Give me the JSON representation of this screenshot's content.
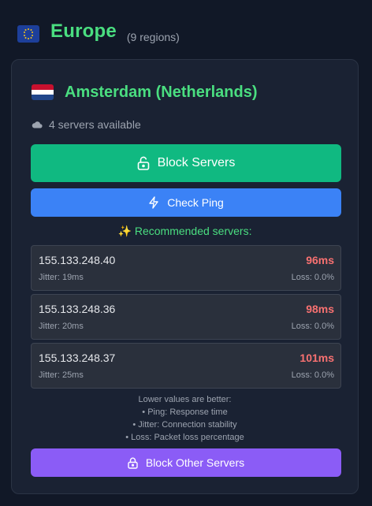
{
  "region": {
    "flag_icon": "eu-flag-icon",
    "title": "Europe",
    "count": "(9 regions)"
  },
  "city": {
    "flag_icon": "netherlands-flag-icon",
    "name": "Amsterdam (Netherlands)",
    "servers_available": "4 servers available"
  },
  "buttons": {
    "block_servers": "Block Servers",
    "check_ping": "Check Ping",
    "block_other": "Block Other Servers"
  },
  "recommended_label": "✨ Recommended servers:",
  "servers": [
    {
      "ip": "155.133.248.40",
      "ping": "96ms",
      "jitter": "Jitter: 19ms",
      "loss": "Loss: 0.0%"
    },
    {
      "ip": "155.133.248.36",
      "ping": "98ms",
      "jitter": "Jitter: 20ms",
      "loss": "Loss: 0.0%"
    },
    {
      "ip": "155.133.248.37",
      "ping": "101ms",
      "jitter": "Jitter: 25ms",
      "loss": "Loss: 0.0%"
    }
  ],
  "hint_lines": [
    "Lower values are better:",
    "• Ping: Response time",
    "• Jitter: Connection stability",
    "• Loss: Packet loss percentage"
  ],
  "colors": {
    "background": "#111827",
    "card": "#1a2233",
    "accent_green": "#4ade80",
    "block_button": "#10b981",
    "ping_button": "#3b82f6",
    "block_other_button": "#8b5cf6",
    "ping_value": "#f87171"
  }
}
